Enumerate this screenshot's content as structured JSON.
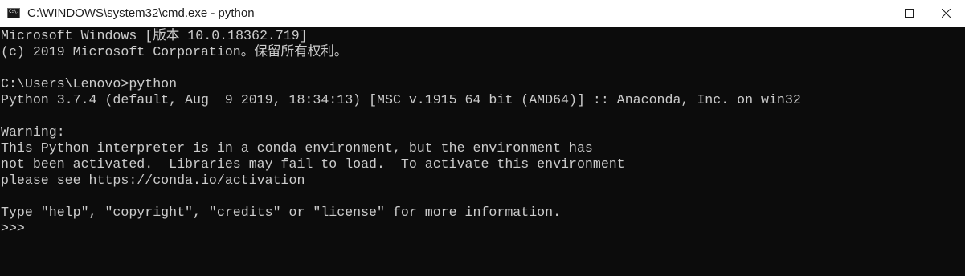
{
  "window": {
    "title": "C:\\WINDOWS\\system32\\cmd.exe - python",
    "icon": "cmd-icon",
    "icon_text": "C:\\."
  },
  "controls": {
    "minimize": "minimize-icon",
    "maximize": "maximize-icon",
    "close": "close-icon"
  },
  "colors": {
    "console_background": "#0c0c0c",
    "console_text": "#cccccc",
    "titlebar_background": "#ffffff"
  },
  "console": {
    "lines": [
      "Microsoft Windows [版本 10.0.18362.719]",
      "(c) 2019 Microsoft Corporation。保留所有权利。",
      "",
      "C:\\Users\\Lenovo>python",
      "Python 3.7.4 (default, Aug  9 2019, 18:34:13) [MSC v.1915 64 bit (AMD64)] :: Anaconda, Inc. on win32",
      "",
      "Warning:",
      "This Python interpreter is in a conda environment, but the environment has",
      "not been activated.  Libraries may fail to load.  To activate this environment",
      "please see https://conda.io/activation",
      "",
      "Type \"help\", \"copyright\", \"credits\" or \"license\" for more information.",
      ">>>"
    ]
  }
}
